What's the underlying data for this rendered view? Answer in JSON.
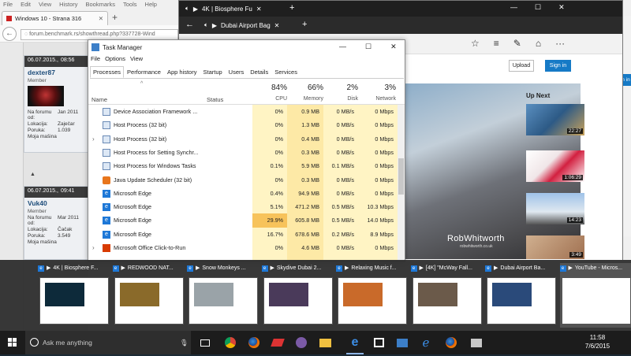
{
  "firefox": {
    "menu": [
      "File",
      "Edit",
      "View",
      "History",
      "Bookmarks",
      "Tools",
      "Help"
    ],
    "tab_title": "Windows 10 - Strana 316",
    "url": "forum.benchmark.rs/showthread.php?337728-Wind",
    "posts": [
      {
        "date": "06.07.2015.,",
        "time": "08:56",
        "user": "dexter87",
        "role": "Member",
        "info": [
          [
            "Na forumu od:",
            "Jan 2011"
          ],
          [
            "Lokacija:",
            "Zaječar"
          ],
          [
            "Poruka:",
            "1.039"
          ],
          [
            "Moja mašina",
            ""
          ]
        ]
      },
      {
        "date": "06.07.2015.,",
        "time": "09:41",
        "user": "Vuk40",
        "role": "Member",
        "info": [
          [
            "Na forumu od:",
            "Mar 2011"
          ],
          [
            "Lokacija:",
            "Čačak"
          ],
          [
            "Poruka:",
            "3.549"
          ],
          [
            "Moja mašina",
            ""
          ]
        ]
      }
    ]
  },
  "edge": {
    "tab1": "4K | Biosphere Fu",
    "tab2": "Dubai Airport Bag",
    "upload": "Upload",
    "signin": "Sign in",
    "up_next": "Up Next",
    "watermark": "RobWhitworth",
    "watermark_sub": "robwhitworth.co.uk",
    "durations": [
      "22:27",
      "1:06:29",
      "14:23",
      "3:49"
    ],
    "signin2": "n in"
  },
  "taskmanager": {
    "title": "Task Manager",
    "menu": [
      "File",
      "Options",
      "View"
    ],
    "tabs": [
      "Processes",
      "Performance",
      "App history",
      "Startup",
      "Users",
      "Details",
      "Services"
    ],
    "header": {
      "name": "Name",
      "status": "Status",
      "cpu_pct": "84%",
      "cpu": "CPU",
      "mem_pct": "66%",
      "mem": "Memory",
      "disk_pct": "2%",
      "disk": "Disk",
      "net_pct": "3%",
      "net": "Network"
    },
    "rows": [
      {
        "name": "Device Association Framework ...",
        "cpu": "0%",
        "mem": "0.9 MB",
        "disk": "0 MB/s",
        "net": "0 Mbps",
        "icon": "service",
        "expand": false
      },
      {
        "name": "Host Process (32 bit)",
        "cpu": "0%",
        "mem": "1.3 MB",
        "disk": "0 MB/s",
        "net": "0 Mbps",
        "icon": "service",
        "expand": false
      },
      {
        "name": "Host Process (32 bit)",
        "cpu": "0%",
        "mem": "0.4 MB",
        "disk": "0 MB/s",
        "net": "0 Mbps",
        "icon": "service",
        "expand": true
      },
      {
        "name": "Host Process for Setting Synchr...",
        "cpu": "0%",
        "mem": "0.3 MB",
        "disk": "0 MB/s",
        "net": "0 Mbps",
        "icon": "service",
        "expand": false
      },
      {
        "name": "Host Process for Windows Tasks",
        "cpu": "0.1%",
        "mem": "5.9 MB",
        "disk": "0.1 MB/s",
        "net": "0 Mbps",
        "icon": "service",
        "expand": false
      },
      {
        "name": "Java Update Scheduler (32 bit)",
        "cpu": "0%",
        "mem": "0.3 MB",
        "disk": "0 MB/s",
        "net": "0 Mbps",
        "icon": "java",
        "expand": false
      },
      {
        "name": "Microsoft Edge",
        "cpu": "0.4%",
        "mem": "94.9 MB",
        "disk": "0 MB/s",
        "net": "0 Mbps",
        "icon": "edge",
        "expand": false
      },
      {
        "name": "Microsoft Edge",
        "cpu": "5.1%",
        "mem": "471.2 MB",
        "disk": "0.5 MB/s",
        "net": "10.3 Mbps",
        "icon": "edge",
        "expand": false
      },
      {
        "name": "Microsoft Edge",
        "cpu": "29.9%",
        "mem": "605.8 MB",
        "disk": "0.5 MB/s",
        "net": "14.0 Mbps",
        "icon": "edge",
        "expand": false
      },
      {
        "name": "Microsoft Edge",
        "cpu": "16.7%",
        "mem": "678.6 MB",
        "disk": "0.2 MB/s",
        "net": "8.9 Mbps",
        "icon": "edge",
        "expand": false
      },
      {
        "name": "Microsoft Office Click-to-Run",
        "cpu": "0%",
        "mem": "4.6 MB",
        "disk": "0 MB/s",
        "net": "0 Mbps",
        "icon": "office",
        "expand": true
      }
    ]
  },
  "thumbnails": [
    {
      "title": "4K | Biosphere F...",
      "selected": false,
      "color": "#0d2a3a"
    },
    {
      "title": "REDWOOD NAT...",
      "selected": false,
      "color": "#8a6a2a"
    },
    {
      "title": "Snow Monkeys ...",
      "selected": false,
      "color": "#9aa3a8"
    },
    {
      "title": "Skydive Dubai 2...",
      "selected": false,
      "color": "#4a3a5a"
    },
    {
      "title": "Relaxing Music f...",
      "selected": false,
      "color": "#c96a2a"
    },
    {
      "title": "[4K] \"McWay Fall...",
      "selected": false,
      "color": "#6b5a4a"
    },
    {
      "title": "Dubai Airport Ba...",
      "selected": false,
      "color": "#2a4a7a"
    },
    {
      "title": "YouTube - Micros...",
      "selected": true,
      "color": "#ffffff"
    }
  ],
  "taskbar": {
    "search_placeholder": "Ask me anything",
    "time": "11:58",
    "date": "7/6/2015"
  }
}
